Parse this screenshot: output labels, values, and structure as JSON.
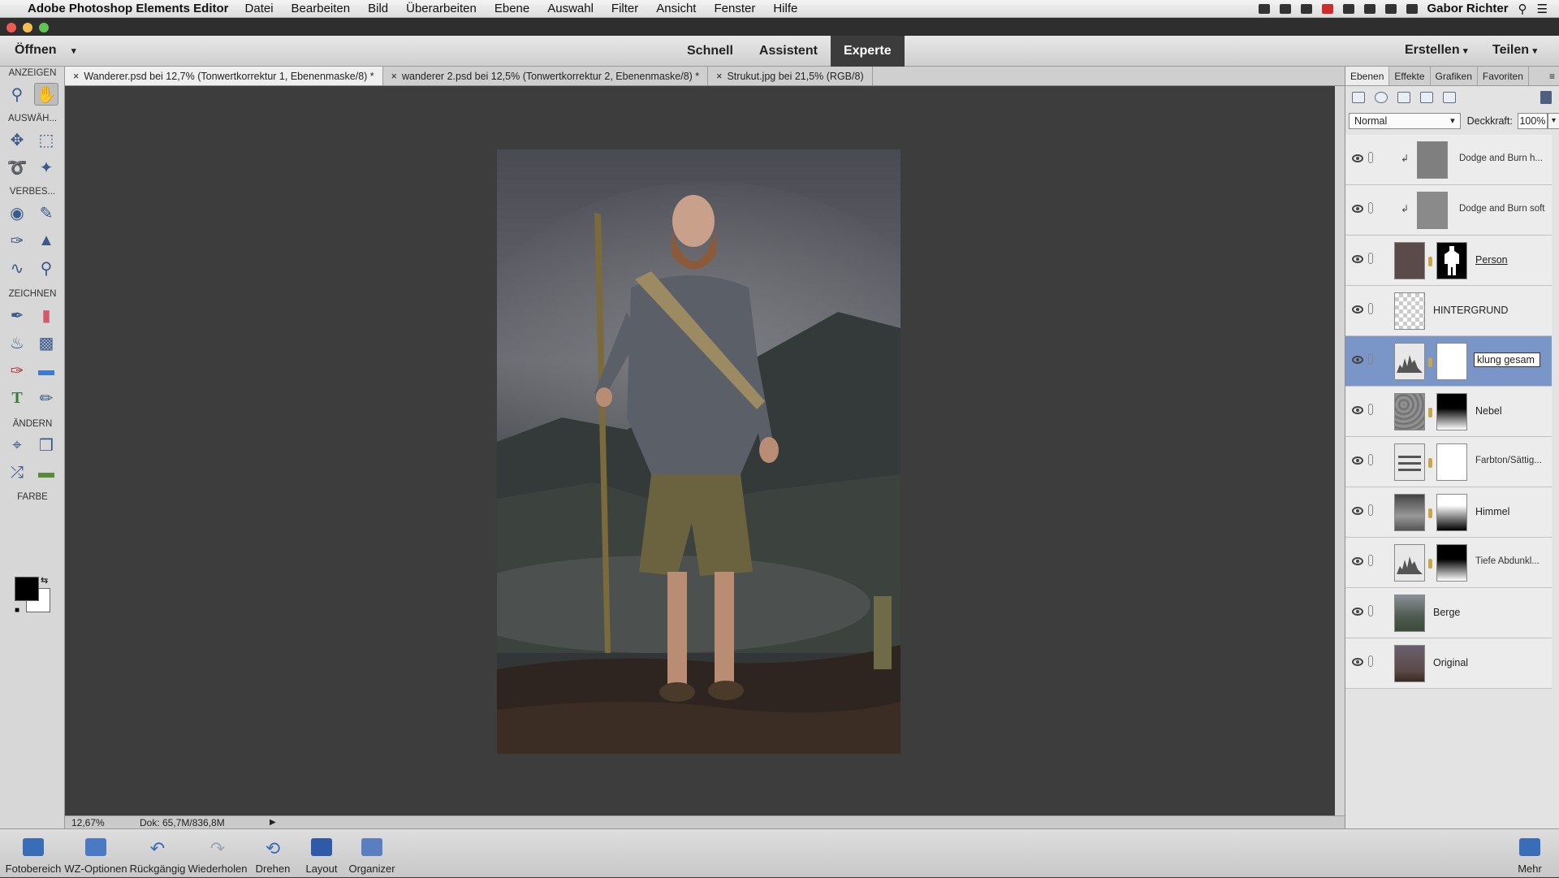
{
  "menubar": {
    "app_name": "Adobe Photoshop Elements Editor",
    "items": [
      "Datei",
      "Bearbeiten",
      "Bild",
      "Überarbeiten",
      "Ebene",
      "Auswahl",
      "Filter",
      "Ansicht",
      "Fenster",
      "Hilfe"
    ],
    "user": "Gabor Richter"
  },
  "header": {
    "open_label": "Öffnen",
    "modes": [
      "Schnell",
      "Assistent",
      "Experte"
    ],
    "active_mode": "Experte",
    "create_label": "Erstellen",
    "share_label": "Teilen"
  },
  "toolbox": {
    "sections": [
      "ANZEIGEN",
      "AUSWÄH...",
      "VERBES...",
      "ZEICHNEN",
      "ÄNDERN",
      "FARBE"
    ]
  },
  "doc_tabs": [
    "Wanderer.psd bei 12,7% (Tonwertkorrektur 1, Ebenenmaske/8) *",
    "wanderer 2.psd bei 12,5% (Tonwertkorrektur 2, Ebenenmaske/8) *",
    "Strukut.jpg bei 21,5% (RGB/8)"
  ],
  "status": {
    "zoom": "12,67%",
    "doc_size": "Dok: 65,7M/836,8M"
  },
  "panel": {
    "tabs": [
      "Ebenen",
      "Effekte",
      "Grafiken",
      "Favoriten"
    ],
    "blend_mode": "Normal",
    "opacity_label": "Deckkraft:",
    "opacity_value": "100%",
    "layers": [
      "Dodge and Burn h...",
      "Dodge and Burn soft",
      "Person",
      "HINTERGRUND",
      "klung gesam",
      "Nebel",
      "Farbton/Sättig...",
      "Himmel",
      "Tiefe Abdunkl...",
      "Berge",
      "Original"
    ]
  },
  "bottombar": {
    "items": [
      "Fotobereich",
      "WZ-Optionen",
      "Rückgängig",
      "Wiederholen",
      "Drehen",
      "Layout",
      "Organizer"
    ],
    "more": "Mehr"
  }
}
